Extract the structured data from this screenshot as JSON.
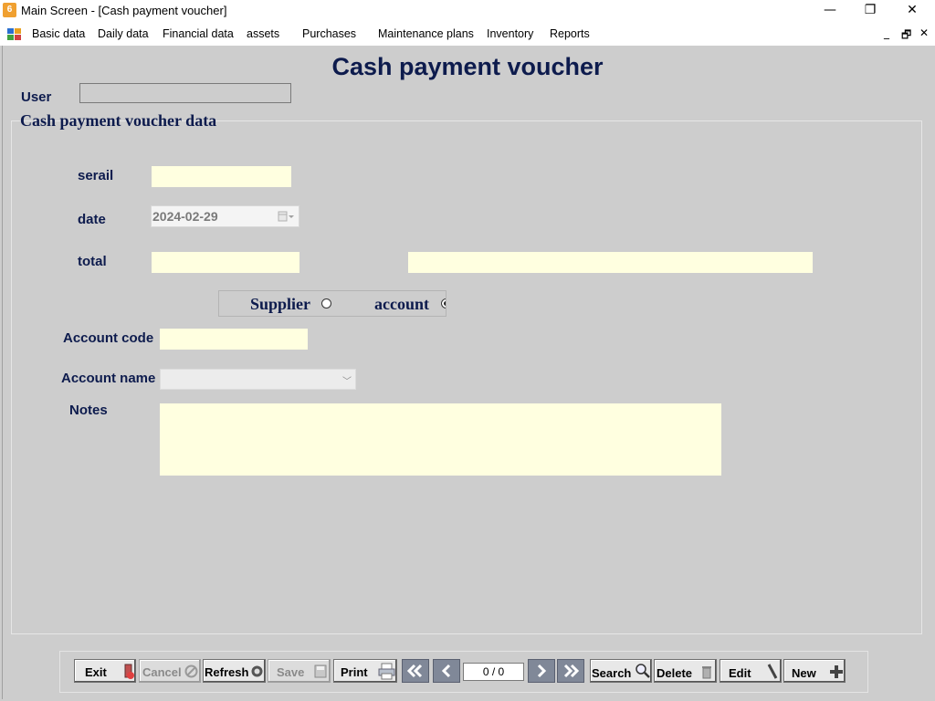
{
  "window": {
    "title": "Main Screen - [Cash payment voucher]",
    "minimize": "—",
    "restore": "❐",
    "close": "✕"
  },
  "menu": {
    "items": [
      "Basic data",
      "Daily data",
      "Financial data",
      "assets",
      "Purchases",
      "Maintenance plans",
      "Inventory",
      "Reports"
    ],
    "mdi_minimize": "_",
    "mdi_restore": "🗗",
    "mdi_close": "✕"
  },
  "form": {
    "title": "Cash payment voucher",
    "user_label": "User",
    "user_value": "",
    "group_title": "Cash payment voucher data",
    "serial_label": "serail",
    "serial_value": "",
    "date_label": "date",
    "date_value": "2024-02-29",
    "total_label": "total",
    "total_value": "",
    "total_text_value": "",
    "radio_supplier": "Supplier",
    "radio_account": "account",
    "account_code_label": "Account code",
    "account_code_value": "",
    "account_name_label": "Account name",
    "account_name_value": "",
    "notes_label": "Notes",
    "notes_value": ""
  },
  "toolbar": {
    "exit": "Exit",
    "cancel": "Cancel",
    "refresh": "Refresh",
    "save": "Save",
    "print": "Print",
    "position": "0 / 0",
    "search": "Search",
    "delete": "Delete",
    "edit": "Edit",
    "new": "New"
  },
  "colors": {
    "field_bg": "#ffffe0",
    "label": "#0d1b4d",
    "client_bg": "#cdcdcd"
  }
}
